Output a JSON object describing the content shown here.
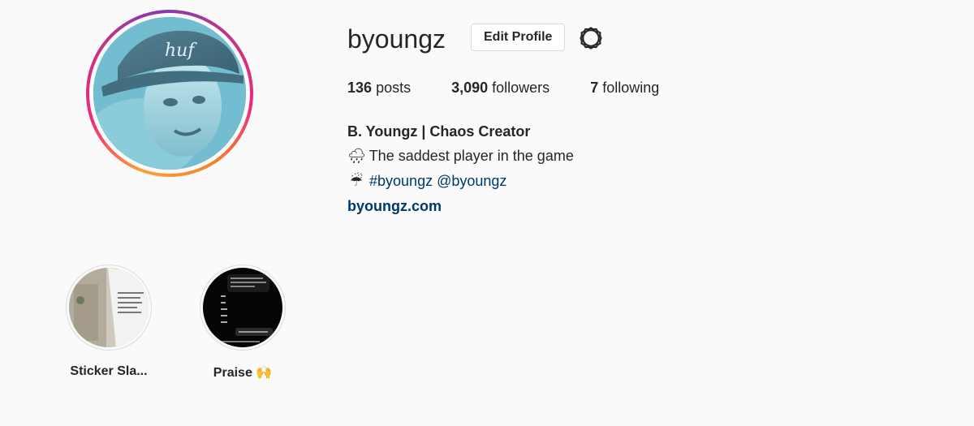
{
  "profile": {
    "username": "byoungz",
    "edit_profile_label": "Edit Profile",
    "settings_icon": "gear-icon",
    "avatar_icon": "profile-photo"
  },
  "stats": {
    "posts_count": "136",
    "posts_label": "posts",
    "followers_count": "3,090",
    "followers_label": "followers",
    "following_count": "7",
    "following_label": "following"
  },
  "bio": {
    "name": "B. Youngz | Chaos Creator",
    "line1_emoji": "🌧",
    "line1_text": "The saddest player in the game",
    "line2_emoji": "☔",
    "hashtag": "#byoungz",
    "mention": "@byoungz",
    "website": "byoungz.com"
  },
  "highlights": [
    {
      "label": "Sticker Sla...",
      "thumb": "wall-with-sticker"
    },
    {
      "label": "Praise 🙌",
      "thumb": "dark-chat-screenshot"
    }
  ],
  "colors": {
    "background": "#fafafa",
    "text": "#262626",
    "link": "#00376b",
    "border": "#dbdbdb"
  }
}
